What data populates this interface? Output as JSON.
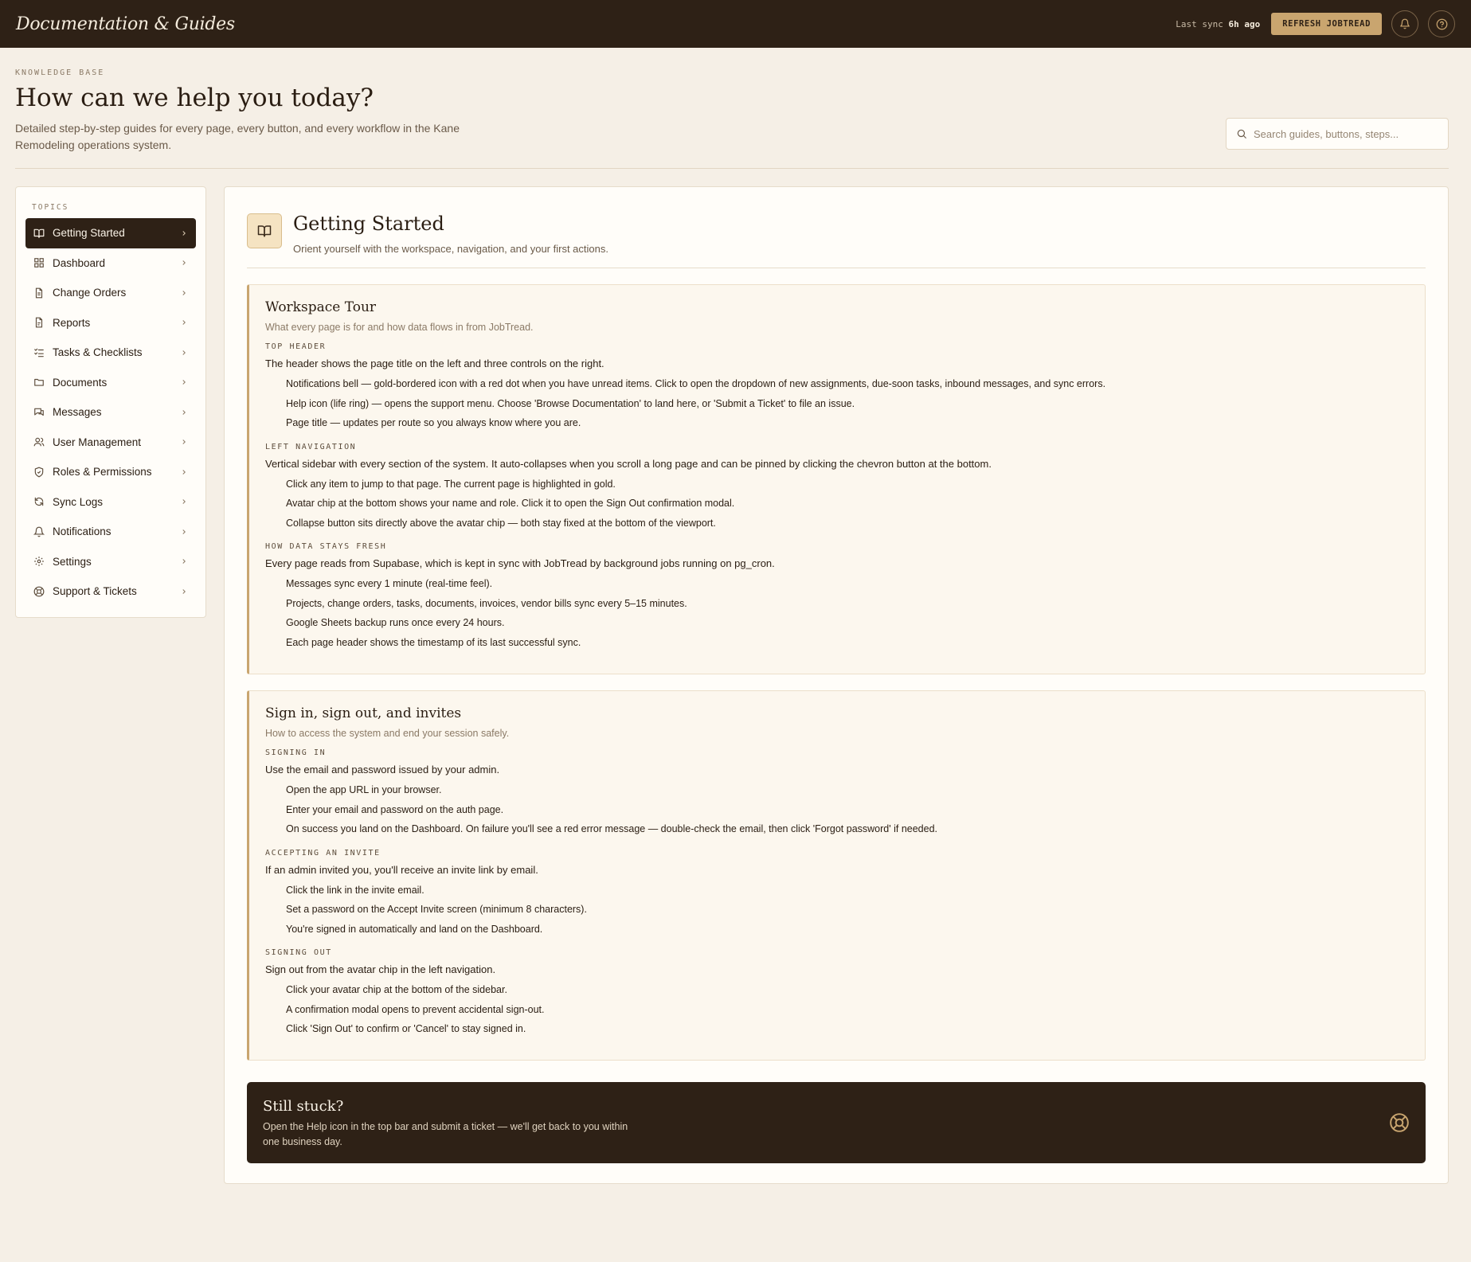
{
  "app": {
    "title": "Documentation & Guides",
    "sync_prefix": "Last sync",
    "sync_age": "6h ago",
    "refresh_label": "REFRESH JOBTREAD"
  },
  "colors": {
    "topbar_bg": "#2e2116",
    "accent_gold": "#c9a56f",
    "page_bg": "#f5efe6",
    "card_bg": "#fcf7ee"
  },
  "icons": {
    "notifications": "bell-icon",
    "help": "help-circle-icon",
    "search": "search-icon",
    "section": "book-open-icon",
    "support": "lifebuoy-icon"
  },
  "header": {
    "eyebrow": "KNOWLEDGE BASE",
    "title": "How can we help you today?",
    "subtitle": "Detailed step-by-step guides for every page, every button, and every workflow in the Kane Remodeling operations system."
  },
  "search": {
    "placeholder": "Search guides, buttons, steps...",
    "value": ""
  },
  "sidebar": {
    "label": "TOPICS",
    "items": [
      {
        "label": "Getting Started",
        "icon": "book-open-icon",
        "active": true
      },
      {
        "label": "Dashboard",
        "icon": "dashboard-grid-icon"
      },
      {
        "label": "Change Orders",
        "icon": "document-icon"
      },
      {
        "label": "Reports",
        "icon": "report-icon"
      },
      {
        "label": "Tasks & Checklists",
        "icon": "checklist-icon"
      },
      {
        "label": "Documents",
        "icon": "folder-icon"
      },
      {
        "label": "Messages",
        "icon": "messages-icon"
      },
      {
        "label": "User Management",
        "icon": "users-icon"
      },
      {
        "label": "Roles & Permissions",
        "icon": "shield-icon"
      },
      {
        "label": "Sync Logs",
        "icon": "sync-icon"
      },
      {
        "label": "Notifications",
        "icon": "bell-icon"
      },
      {
        "label": "Settings",
        "icon": "gear-icon"
      },
      {
        "label": "Support & Tickets",
        "icon": "lifebuoy-icon"
      }
    ]
  },
  "section": {
    "title": "Getting Started",
    "subtitle": "Orient yourself with the workspace, navigation, and your first actions.",
    "cards": [
      {
        "title": "Workspace Tour",
        "subtitle": "What every page is for and how data flows in from JobTread.",
        "groups": [
          {
            "label": "TOP HEADER",
            "intro": "The header shows the page title on the left and three controls on the right.",
            "steps": [
              "Notifications bell — gold-bordered icon with a red dot when you have unread items. Click to open the dropdown of new assignments, due-soon tasks, inbound messages, and sync errors.",
              "Help icon (life ring) — opens the support menu. Choose 'Browse Documentation' to land here, or 'Submit a Ticket' to file an issue.",
              "Page title — updates per route so you always know where you are."
            ]
          },
          {
            "label": "LEFT NAVIGATION",
            "intro": "Vertical sidebar with every section of the system. It auto-collapses when you scroll a long page and can be pinned by clicking the chevron button at the bottom.",
            "steps": [
              "Click any item to jump to that page. The current page is highlighted in gold.",
              "Avatar chip at the bottom shows your name and role. Click it to open the Sign Out confirmation modal.",
              "Collapse button sits directly above the avatar chip — both stay fixed at the bottom of the viewport."
            ]
          },
          {
            "label": "HOW DATA STAYS FRESH",
            "intro": "Every page reads from Supabase, which is kept in sync with JobTread by background jobs running on pg_cron.",
            "steps": [
              "Messages sync every 1 minute (real-time feel).",
              "Projects, change orders, tasks, documents, invoices, vendor bills sync every 5–15 minutes.",
              "Google Sheets backup runs once every 24 hours.",
              "Each page header shows the timestamp of its last successful sync."
            ]
          }
        ]
      },
      {
        "title": "Sign in, sign out, and invites",
        "subtitle": "How to access the system and end your session safely.",
        "groups": [
          {
            "label": "SIGNING IN",
            "intro": "Use the email and password issued by your admin.",
            "steps": [
              "Open the app URL in your browser.",
              "Enter your email and password on the auth page.",
              "On success you land on the Dashboard. On failure you'll see a red error message — double-check the email, then click 'Forgot password' if needed."
            ]
          },
          {
            "label": "ACCEPTING AN INVITE",
            "intro": "If an admin invited you, you'll receive an invite link by email.",
            "steps": [
              "Click the link in the invite email.",
              "Set a password on the Accept Invite screen (minimum 8 characters).",
              "You're signed in automatically and land on the Dashboard."
            ]
          },
          {
            "label": "SIGNING OUT",
            "intro": "Sign out from the avatar chip in the left navigation.",
            "steps": [
              "Click your avatar chip at the bottom of the sidebar.",
              "A confirmation modal opens to prevent accidental sign-out.",
              "Click 'Sign Out' to confirm or 'Cancel' to stay signed in."
            ]
          }
        ]
      }
    ]
  },
  "cta": {
    "title": "Still stuck?",
    "text": "Open the Help icon in the top bar and submit a ticket — we'll get back to you within one business day."
  }
}
